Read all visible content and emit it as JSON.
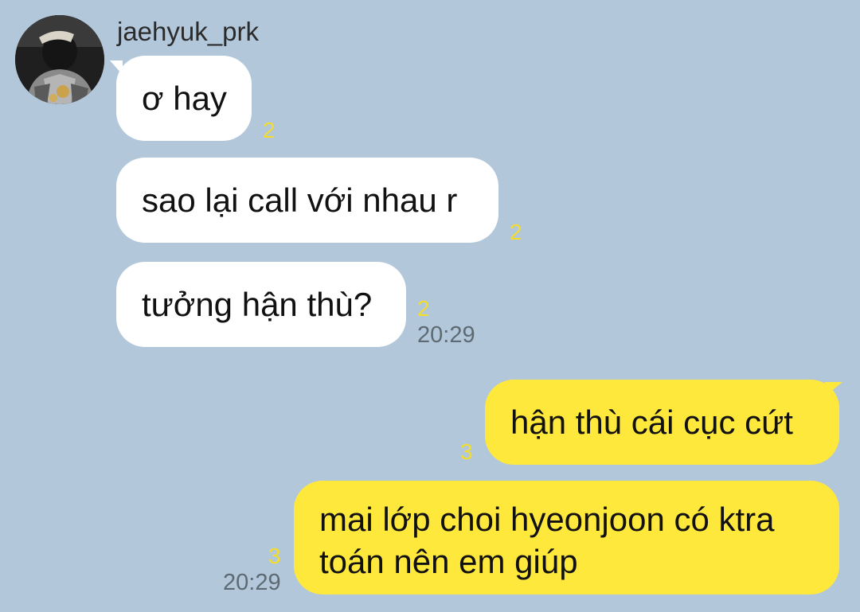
{
  "chat": {
    "sender": {
      "name": "jaehyuk_prk",
      "avatar_icon": "profile-photo"
    },
    "incoming": [
      {
        "text": "ơ hay",
        "unread": "2"
      },
      {
        "text": "sao lại call với nhau r",
        "unread": "2"
      },
      {
        "text": "tưởng hận thù?",
        "unread": "2",
        "time": "20:29"
      }
    ],
    "outgoing": [
      {
        "text": "hận thù cái cục cứt",
        "unread": "3"
      },
      {
        "lines": [
          "mai lớp choi hyeonjoon có ktra",
          "toán nên em giúp"
        ],
        "unread": "3",
        "time": "20:29"
      }
    ]
  },
  "colors": {
    "background": "#b2c7da",
    "incoming_bubble": "#ffffff",
    "outgoing_bubble": "#fee83c",
    "unread_count": "#f3dd2c",
    "timestamp": "#5e6a73"
  }
}
